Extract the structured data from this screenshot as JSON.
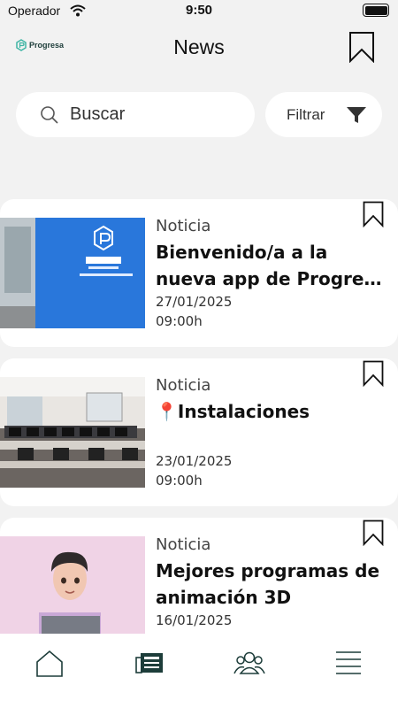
{
  "status_bar": {
    "carrier": "Operador",
    "time": "9:50"
  },
  "header": {
    "logo_text": "Progresa",
    "title": "News"
  },
  "search": {
    "placeholder": "Buscar"
  },
  "filter": {
    "label": "Filtrar"
  },
  "news": [
    {
      "type": "Noticia",
      "title": "Bienvenido/a a la nueva app de Progre…",
      "date": "27/01/2025",
      "time": "09:00h",
      "image": "progresa-office-wall"
    },
    {
      "type": "Noticia",
      "title": "📍Instalaciones",
      "date": "23/01/2025",
      "time": "09:00h",
      "image": "computer-classroom"
    },
    {
      "type": "Noticia",
      "title": "Mejores programas de animación 3D",
      "date": "16/01/2025",
      "time": "",
      "image": "3d-character"
    }
  ],
  "icons": {
    "header": [
      "progresa-logo-icon",
      "bookmark-icon"
    ],
    "bottom_nav": [
      "home-icon",
      "newspaper-icon",
      "community-icon",
      "menu-icon"
    ]
  },
  "colors": {
    "accent": "#1d3d3a",
    "background": "#f2f2f2",
    "card": "#ffffff"
  }
}
